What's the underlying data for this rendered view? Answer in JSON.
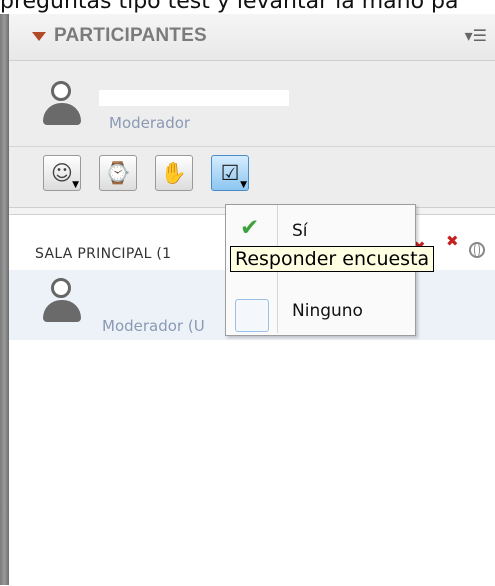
{
  "top_caption": "preguntas tipo test y levantar la mano pa",
  "header": {
    "title": "PARTICIPANTES",
    "menu_icon": "list-menu-icon"
  },
  "self": {
    "role": "Moderador"
  },
  "toolbar": {
    "buttons": [
      {
        "icon": "emoticon-icon"
      },
      {
        "icon": "status-clock-icon"
      },
      {
        "icon": "raise-hand-icon"
      },
      {
        "icon": "poll-checkbox-icon"
      }
    ]
  },
  "room": {
    "label": "SALA PRINCIPAL (1",
    "participant": {
      "role": "Moderador (U"
    }
  },
  "poll_menu": {
    "items": [
      {
        "label": "Sí"
      },
      {
        "label": "Ninguno"
      }
    ]
  },
  "tooltip": "Responder encuesta",
  "colors": {
    "check": "#3ea13e",
    "role_text": "#8a9ab4",
    "title_text": "#7b7b7b"
  }
}
